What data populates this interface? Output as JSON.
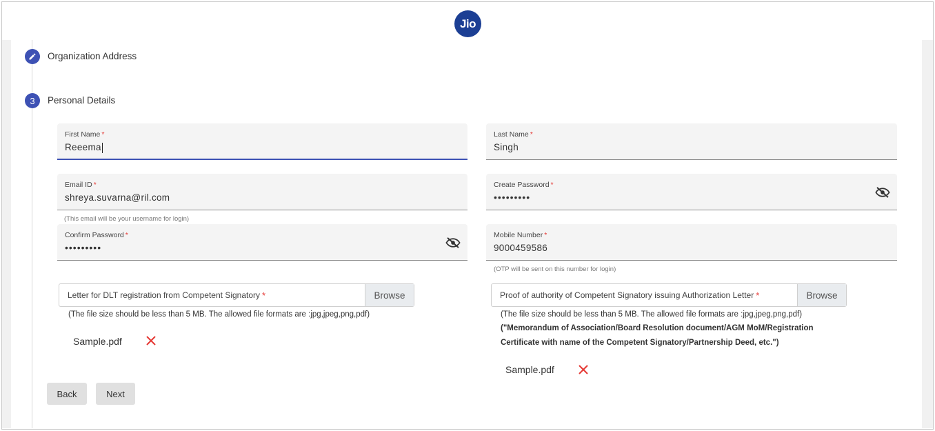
{
  "header": {
    "logo_text": "Jio"
  },
  "steps": [
    {
      "label": "Organization Address",
      "icon": "pencil-icon",
      "state": "completed"
    },
    {
      "label": "Personal Details",
      "number": "3",
      "state": "active"
    }
  ],
  "form": {
    "first_name": {
      "label": "First Name",
      "value": "Reeema"
    },
    "last_name": {
      "label": "Last Name",
      "value": "Singh"
    },
    "email": {
      "label": "Email ID",
      "value": "shreya.suvarna@ril.com",
      "hint": "(This email will be your username for login)"
    },
    "create_password": {
      "label": "Create Password",
      "value": "•••••••••"
    },
    "confirm_password": {
      "label": "Confirm Password",
      "value": "•••••••••"
    },
    "mobile": {
      "label": "Mobile Number",
      "value": "9000459586",
      "hint": "(OTP will be sent on this number for login)"
    },
    "required_marker": "*"
  },
  "uploads": {
    "dlt_letter": {
      "label": "Letter for DLT registration from Competent Signatory",
      "browse_label": "Browse",
      "note": "(The file size should be less than 5 MB. The allowed file formats are :jpg,jpeg,png,pdf)",
      "file_name": "Sample.pdf"
    },
    "proof_authority": {
      "label": "Proof of authority of Competent Signatory issuing Authorization Letter",
      "browse_label": "Browse",
      "note": "(The file size should be less than 5 MB. The allowed file formats are :jpg,jpeg,png,pdf)",
      "note_bold": "(\"Memorandum of Association/Board Resolution document/AGM MoM/Registration Certificate with name of the Competent Signatory/Partnership Deed, etc.\")",
      "file_name": "Sample.pdf"
    }
  },
  "actions": {
    "back_label": "Back",
    "next_label": "Next"
  },
  "colors": {
    "accent": "#3d51b4",
    "remove": "#e53935",
    "logo_bg": "#1c3f94"
  }
}
